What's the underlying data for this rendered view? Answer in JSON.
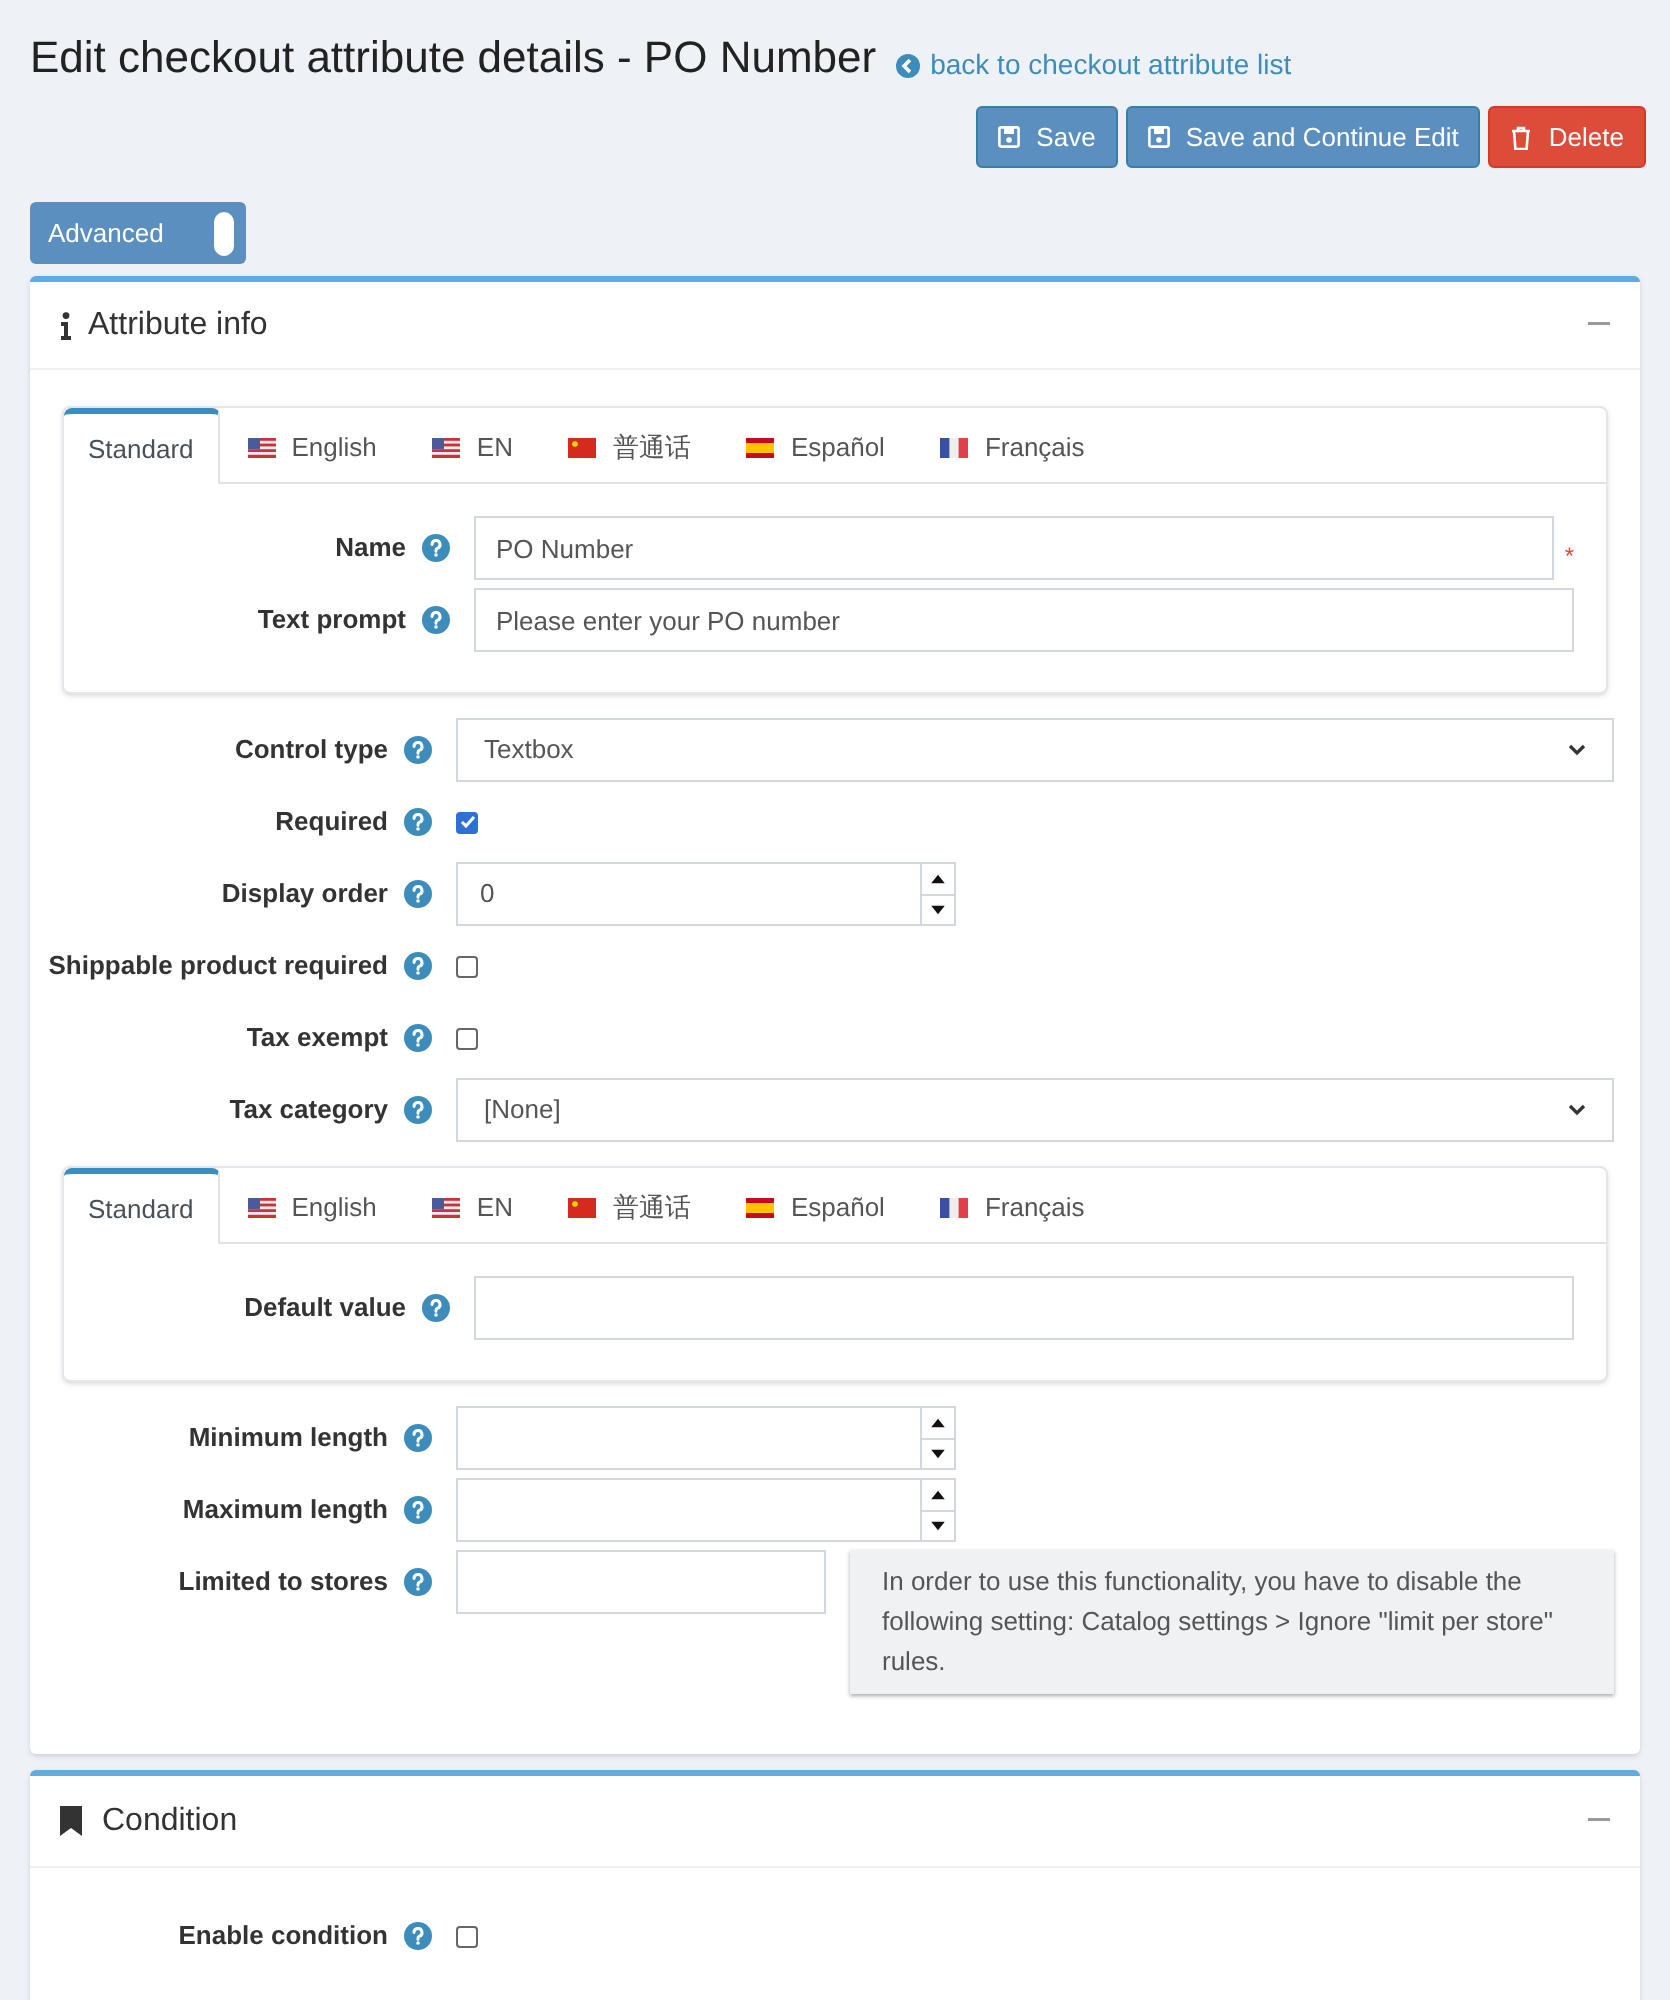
{
  "title": "Edit checkout attribute details - PO Number",
  "back_link": "back to checkout attribute list",
  "buttons": [
    {
      "label": "Save",
      "kind": "save"
    },
    {
      "label": "Save and Continue Edit",
      "kind": "save"
    },
    {
      "label": "Delete",
      "kind": "delete"
    }
  ],
  "advanced_toggle": {
    "label": "Advanced",
    "on": true
  },
  "attribute_info": {
    "title": "Attribute info",
    "localized_top": {
      "tabs": [
        {
          "label": "Standard",
          "kind": "none",
          "selected": true
        },
        {
          "label": "English",
          "kind": "us",
          "selected": false
        },
        {
          "label": "EN",
          "kind": "us",
          "selected": false
        },
        {
          "label": "普通话",
          "kind": "cn",
          "selected": false
        },
        {
          "label": "Español",
          "kind": "es",
          "selected": false
        },
        {
          "label": "Français",
          "kind": "fr",
          "selected": false
        }
      ],
      "fields": [
        {
          "label": "Name",
          "value": "PO Number",
          "marker": "*"
        },
        {
          "label": "Text prompt",
          "value": "Please enter your PO number"
        }
      ]
    },
    "fields": [
      {
        "kind": "select",
        "label": "Control type",
        "value": "Textbox"
      },
      {
        "kind": "checkbox",
        "label": "Required",
        "checked": true
      },
      {
        "kind": "number",
        "label": "Display order",
        "value": "0"
      },
      {
        "kind": "checkbox",
        "label": "Shippable product required",
        "checked": false
      },
      {
        "kind": "checkbox",
        "label": "Tax exempt",
        "checked": false
      },
      {
        "kind": "select",
        "label": "Tax category",
        "value": "[None]"
      }
    ],
    "localized_bottom": {
      "tabs": [
        {
          "label": "Standard",
          "kind": "none",
          "selected": true
        },
        {
          "label": "English",
          "kind": "us",
          "selected": false
        },
        {
          "label": "EN",
          "kind": "us",
          "selected": false
        },
        {
          "label": "普通话",
          "kind": "cn",
          "selected": false
        },
        {
          "label": "Español",
          "kind": "es",
          "selected": false
        },
        {
          "label": "Français",
          "kind": "fr",
          "selected": false
        }
      ],
      "fields": [
        {
          "label": "Default value"
        }
      ]
    },
    "fields_after": [
      {
        "kind": "number",
        "label": "Minimum length"
      },
      {
        "kind": "number",
        "label": "Maximum length"
      },
      {
        "kind": "stores",
        "label": "Limited to stores",
        "note": "In order to use this functionality, you have to disable the following setting: Catalog settings > Ignore \"limit per store\" rules."
      }
    ]
  },
  "condition": {
    "title": "Condition",
    "fields": [
      {
        "kind": "checkbox",
        "label": "Enable condition",
        "checked": false
      }
    ]
  }
}
